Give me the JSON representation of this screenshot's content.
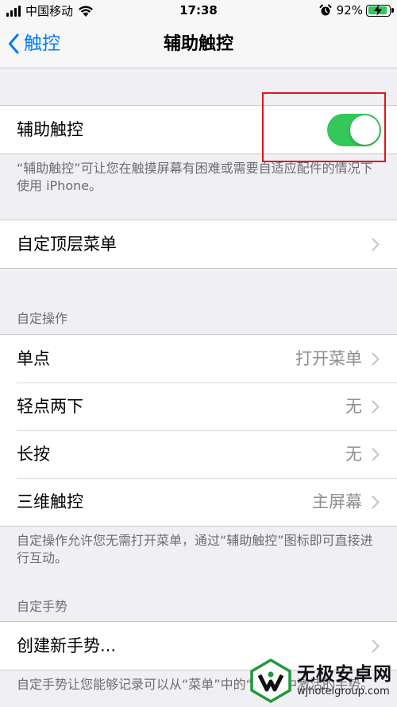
{
  "status_bar": {
    "carrier": "中国移动",
    "time": "17:38",
    "battery_percent": "92%",
    "battery_level": 0.92,
    "icons": [
      "signal-icon",
      "wifi-icon",
      "alarm-icon",
      "battery-icon"
    ]
  },
  "nav": {
    "back_label": "触控",
    "title": "辅助触控"
  },
  "assistive_touch": {
    "label": "辅助触控",
    "toggle_on": true,
    "footer": "“辅助触控”可让您在触摸屏幕有困难或需要自适应配件的情况下使用 iPhone。"
  },
  "top_menu": {
    "label": "自定顶层菜单"
  },
  "custom_actions": {
    "header": "自定操作",
    "rows": [
      {
        "label": "单点",
        "value": "打开菜单"
      },
      {
        "label": "轻点两下",
        "value": "无"
      },
      {
        "label": "长按",
        "value": "无"
      },
      {
        "label": "三维触控",
        "value": "主屏幕"
      }
    ],
    "footer": "自定操作允许您无需打开菜单，通过“辅助触控”图标即可直接进行互动。"
  },
  "custom_gestures": {
    "header": "自定手势",
    "create_label": "创建新手势...",
    "footer": "自定手势让您能够记录可以从“菜单”中的“自定”中激活的手势。"
  },
  "watermark": {
    "title": "无极安卓网",
    "url": "wjhotelgroup.com"
  },
  "colors": {
    "accent": "#007aff",
    "toggle_on": "#34c759",
    "background": "#efeff4",
    "highlight": "#e1141b"
  }
}
